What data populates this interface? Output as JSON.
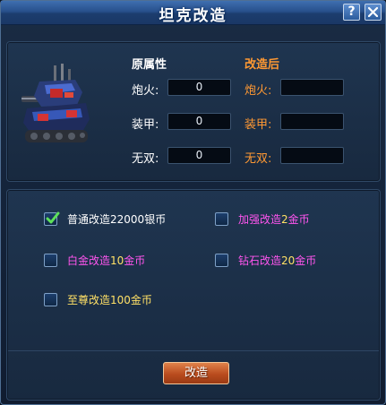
{
  "window": {
    "title": "坦克改造"
  },
  "titlebar": {
    "help_label": "?"
  },
  "stats": {
    "before_header": "原属性",
    "after_header": "改造后",
    "rows": [
      {
        "label": "炮火:",
        "before": "0",
        "after": "",
        "after_label": "炮火:"
      },
      {
        "label": "装甲:",
        "before": "0",
        "after": "",
        "after_label": "装甲:"
      },
      {
        "label": "无双:",
        "before": "0",
        "after": "",
        "after_label": "无双:"
      }
    ]
  },
  "options": [
    {
      "label_prefix": "普通改造",
      "cost": "22000",
      "unit": "银币",
      "checked": true,
      "color": "#ffffff"
    },
    {
      "label_prefix": "加强改造",
      "cost": "2",
      "unit": "金币",
      "checked": false,
      "color": "#ff55ee"
    },
    {
      "label_prefix": "白金改造",
      "cost": "10",
      "unit": "金币",
      "checked": false,
      "color": "#ff55ee"
    },
    {
      "label_prefix": "钻石改造",
      "cost": "20",
      "unit": "金币",
      "checked": false,
      "color": "#ff55ee"
    },
    {
      "label_prefix": "至尊改造",
      "cost": "100",
      "unit": "金币",
      "checked": false,
      "color": "#ffe066"
    }
  ],
  "action": {
    "label": "改造"
  },
  "colors": {
    "before_header": "#ffffff",
    "after_header": "#ff9933",
    "after_label": "#ff9933",
    "label": "#ffffff",
    "cost_number": "#ffe066"
  }
}
